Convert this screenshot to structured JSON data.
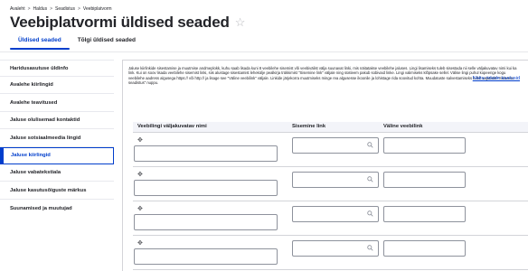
{
  "breadcrumb": {
    "items": [
      "Avaleht",
      "Haldus",
      "Seadistus",
      "Veebiplatvorm"
    ],
    "separator": ">"
  },
  "page": {
    "title": "Veebiplatvormi üldised seaded",
    "star_icon": "star-outline-icon"
  },
  "tabs": [
    {
      "label": "Üldised seaded",
      "active": true
    },
    {
      "label": "Tõlgi üldised seaded",
      "active": false
    }
  ],
  "sidebar": {
    "items": [
      {
        "label": "Haridusasutuse üldinfo"
      },
      {
        "label": "Avalehe kiirlingid"
      },
      {
        "label": "Avalehe teavitused"
      },
      {
        "label": "Jaluse olulisemad kontaktid"
      },
      {
        "label": "Jaluse sotsiaalmeedia lingid"
      },
      {
        "label": "Jaluse kiirlingid",
        "active": true
      },
      {
        "label": "Jaluse vabatekstiala"
      },
      {
        "label": "Jaluse kasutusõiguste märkus"
      },
      {
        "label": "Suunamised ja muutujad"
      }
    ]
  },
  "main": {
    "description": "Jaluse kiirlinkide sisestamise ja muutmise andmeplokk, kuhu saab lisada kuni 8 veebilehe sisemist või veebivälist välja suunavat linki, mis näitatakse veebilehe jaluses. Lingi lisamiseks tuleb sisestada nii selle väljakuvatav nimi kui ka link. Kui on soov lisada veebilehe sisemist linki, siis alustage sisestamist lehekülje pealkirja trükkimist \"Sisemine link\" väljale ning süsteem pakub sobivaid linke. Lingi valimiseks klõpsake sellel. Välise lingi puhul kopeerige kogu veebilehe aadress algusega https:// või http:// ja lisage see \"Väline veebilink\" väljale. Linkide järjekorra muutmiseks minge rea algusesse ikoonile ja lohistage rida soovitud kohta. Muudatuste salvestamiseks tuleb vajutada \"Salvesta seadistus\" nuppu.",
    "show_weights": "Näita ridade kaalusid",
    "table": {
      "columns": [
        "Veebilingi väljakuvatav nimi",
        "Sisemine link",
        "Väline veebilink"
      ],
      "rows": [
        {
          "name": "",
          "internal": "",
          "external": ""
        },
        {
          "name": "",
          "internal": "",
          "external": ""
        },
        {
          "name": "",
          "internal": "",
          "external": ""
        },
        {
          "name": "",
          "internal": "",
          "external": ""
        }
      ]
    }
  },
  "colors": {
    "accent": "#003ecc",
    "text": "#232429",
    "border": "#d4d4d8"
  }
}
